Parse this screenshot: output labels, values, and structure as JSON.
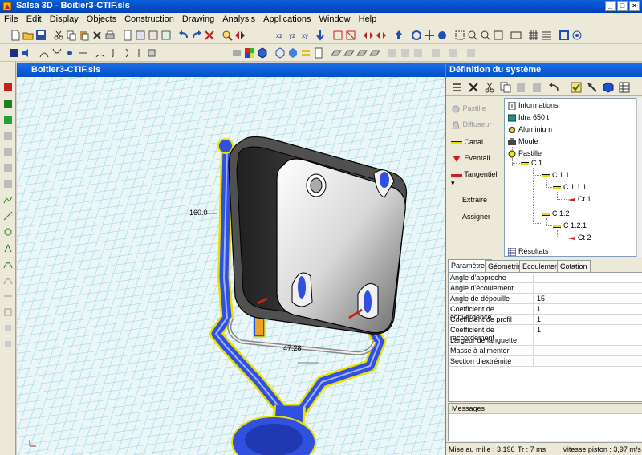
{
  "window": {
    "title": "Salsa 3D - Boitier3-CTIF.sls"
  },
  "menu": [
    "File",
    "Edit",
    "Display",
    "Objects",
    "Construction",
    "Drawing",
    "Analysis",
    "Applications",
    "Window",
    "Help"
  ],
  "viewport": {
    "title": "Boitier3-CTIF.sls",
    "dim_labels": [
      "160.0",
      "47.28"
    ]
  },
  "panel": {
    "title": "Définition du système",
    "elements": [
      {
        "label": "Pastille",
        "enabled": false,
        "icon": "circle-icon",
        "color": "#a0a0a0"
      },
      {
        "label": "Diffuseur",
        "enabled": false,
        "icon": "diffuser-icon",
        "color": "#a0a0a0"
      },
      {
        "label": "Canal",
        "enabled": true,
        "icon": "channel-icon",
        "color": "#1a1a1a"
      },
      {
        "label": "Eventail",
        "enabled": true,
        "icon": "fan-icon",
        "color": "#cc2020"
      },
      {
        "label": "Tangentiel",
        "enabled": true,
        "icon": "tangential-icon",
        "color": "#cc2020"
      }
    ],
    "actions": [
      "Extraire",
      "Assigner"
    ],
    "tree": [
      {
        "label": "Informations",
        "icon": "info-icon",
        "level": 0
      },
      {
        "label": "Idra 650 t",
        "icon": "machine-icon",
        "level": 0
      },
      {
        "label": "Aluminium",
        "icon": "material-icon",
        "level": 0
      },
      {
        "label": "Moule",
        "icon": "mold-icon",
        "level": 0
      },
      {
        "label": "Pastille",
        "icon": "pastille-icon",
        "level": 1
      },
      {
        "label": "C 1",
        "icon": "channel-icon",
        "level": 2
      },
      {
        "label": "C 1.1",
        "icon": "channel-icon",
        "level": 3
      },
      {
        "label": "C 1.1.1",
        "icon": "channel-icon",
        "level": 4
      },
      {
        "label": "Ct 1",
        "icon": "tangential-icon",
        "level": 5
      },
      {
        "label": "C 1.2",
        "icon": "channel-icon",
        "level": 3
      },
      {
        "label": "C 1.2.1",
        "icon": "channel-icon",
        "level": 4
      },
      {
        "label": "Ct 2",
        "icon": "tangential-icon",
        "level": 5
      },
      {
        "label": "Résultats",
        "icon": "results-icon",
        "level": 0
      }
    ],
    "tabs": [
      "Paramètres",
      "Géométrie",
      "Ecoulement",
      "Cotation"
    ],
    "active_tab": "Paramètres",
    "params": [
      {
        "label": "Angle d'approche",
        "value": ""
      },
      {
        "label": "Angle d'écoulement",
        "value": ""
      },
      {
        "label": "Angle de dépouille",
        "value": "15"
      },
      {
        "label": "Coefficient de convergence",
        "value": "1"
      },
      {
        "label": "Coefficient de profil",
        "value": "1"
      },
      {
        "label": "Coefficient de raccordement",
        "value": "1"
      },
      {
        "label": "Largeur de languette",
        "value": ""
      },
      {
        "label": "Masse à alimenter",
        "value": ""
      },
      {
        "label": "Section d'extrémité",
        "value": ""
      }
    ],
    "messages_header": "Messages"
  },
  "status": {
    "mise_au_mille": "Mise au mille : 3,196",
    "tr": "Tr : 7 ms",
    "vitesse": "Vitesse piston : 3,97 m/s"
  },
  "colors": {
    "title_bar": "#0a5fd8",
    "grid": "#8fd0dc",
    "channel_blue": "#3050e0",
    "channel_yellow": "#e8e000"
  }
}
